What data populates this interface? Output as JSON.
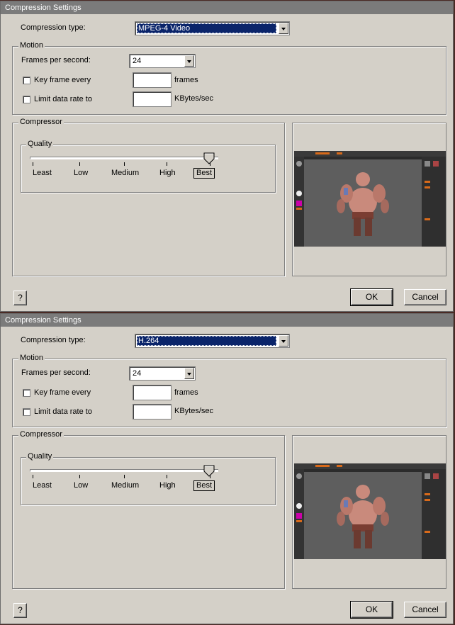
{
  "dialogs": [
    {
      "title": "Compression Settings",
      "compression_type_label": "Compression type:",
      "compression_type_value": "MPEG-4 Video",
      "motion_group": "Motion",
      "fps_label": "Frames per second:",
      "fps_value": "24",
      "keyframe_label": "Key frame every",
      "keyframe_unit": "frames",
      "keyframe_value": "",
      "keyframe_checked": false,
      "datarate_label": "Limit data rate to",
      "datarate_unit": "KBytes/sec",
      "datarate_value": "",
      "datarate_checked": false,
      "compressor_group": "Compressor",
      "quality_group": "Quality",
      "quality_ticks": [
        "Least",
        "Low",
        "Medium",
        "High",
        "Best"
      ],
      "quality_selected": "Best",
      "help_label": "?",
      "ok_label": "OK",
      "cancel_label": "Cancel"
    },
    {
      "title": "Compression Settings",
      "compression_type_label": "Compression type:",
      "compression_type_value": "H.264",
      "motion_group": "Motion",
      "fps_label": "Frames per second:",
      "fps_value": "24",
      "keyframe_label": "Key frame every",
      "keyframe_unit": "frames",
      "keyframe_value": "",
      "keyframe_checked": false,
      "datarate_label": "Limit data rate to",
      "datarate_unit": "KBytes/sec",
      "datarate_value": "",
      "datarate_checked": false,
      "compressor_group": "Compressor",
      "quality_group": "Quality",
      "quality_ticks": [
        "Least",
        "Low",
        "Medium",
        "High",
        "Best"
      ],
      "quality_selected": "Best",
      "help_label": "?",
      "ok_label": "OK",
      "cancel_label": "Cancel"
    }
  ],
  "colors": {
    "dialog_bg": "#d4d0c8",
    "titlebar": "#7b7b7b",
    "selection": "#0a246a",
    "preview_bg": "#2b2b2b",
    "character_skin": "#c98a7c"
  }
}
